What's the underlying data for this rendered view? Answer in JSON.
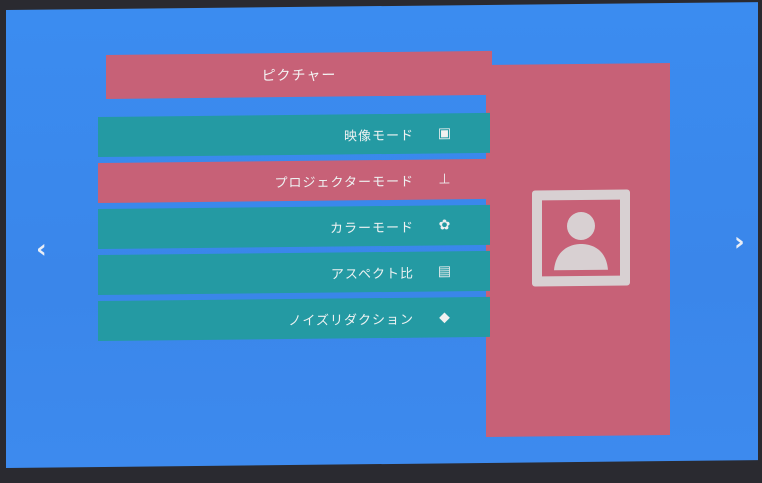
{
  "screen": {
    "title": "ピクチャー",
    "nav": {
      "prev": "‹",
      "next": "›"
    },
    "menu": [
      {
        "label": "映像モード",
        "icon": "picture-mode-icon",
        "glyph": "▣",
        "active": false
      },
      {
        "label": "プロジェクターモード",
        "icon": "projector-icon",
        "glyph": "⊥",
        "active": true
      },
      {
        "label": "カラーモード",
        "icon": "color-palette-icon",
        "glyph": "✿",
        "active": false
      },
      {
        "label": "アスペクト比",
        "icon": "aspect-ratio-icon",
        "glyph": "▤",
        "active": false
      },
      {
        "label": "ノイズリダクション",
        "icon": "noise-reduction-icon",
        "glyph": "◆",
        "active": false
      }
    ],
    "preview_icon": "user-portrait-icon"
  },
  "colors": {
    "background": "#3b8cf0",
    "menu_item": "#249aa3",
    "highlight": "#c76177",
    "text": "#eef2f2"
  }
}
